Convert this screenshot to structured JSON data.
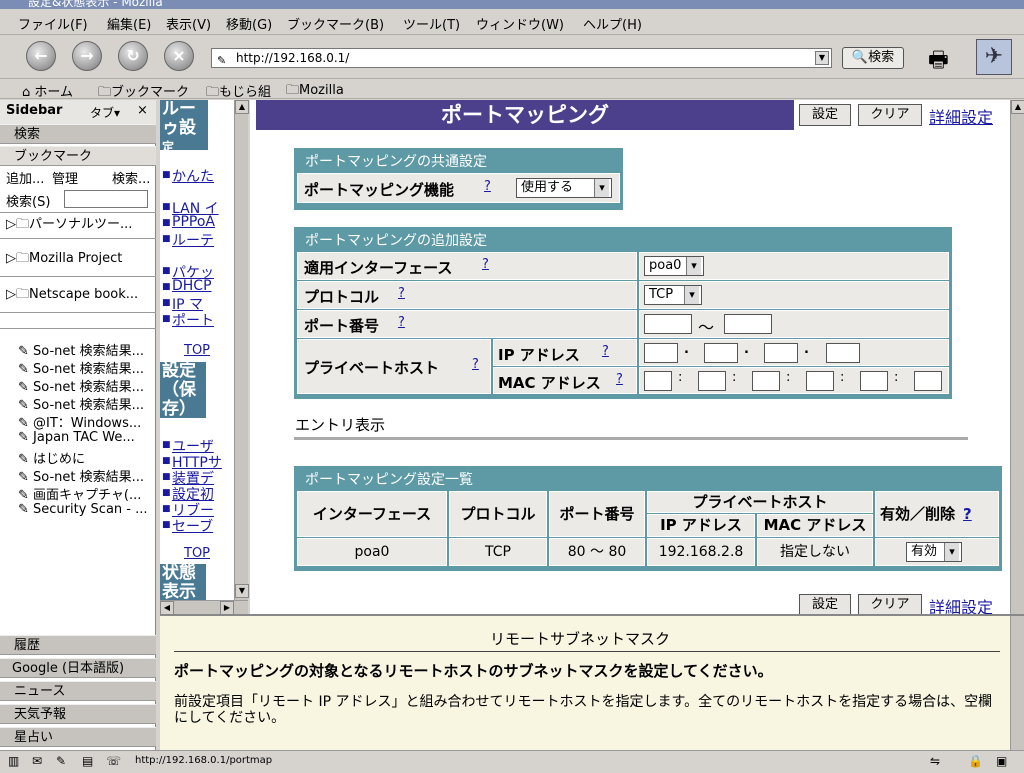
{
  "window": {
    "title": "設定&状態表示 - Mozilla"
  },
  "menu": [
    "ファイル(F)",
    "編集(E)",
    "表示(V)",
    "移動(G)",
    "ブックマーク(B)",
    "ツール(T)",
    "ウィンドウ(W)",
    "ヘルプ(H)"
  ],
  "nav": {
    "url": "http://192.168.0.1/",
    "search_label": "検索"
  },
  "bookmarks_bar": [
    "ホーム",
    "ブックマーク",
    "もじら組",
    "Mozilla"
  ],
  "sidebar": {
    "title": "Sidebar",
    "tabs_label": "タブ",
    "close": "×",
    "tab_search": "検索",
    "tab_bookmarks": "ブックマーク",
    "actions": [
      "追加...",
      "管理",
      "検索..."
    ],
    "search_label": "検索(S)",
    "folders": [
      "パーソナルツー...",
      "Mozilla Project",
      "Netscape book..."
    ],
    "items": [
      "So-net 検索結果...",
      "So-net 検索結果...",
      "So-net 検索結果...",
      "So-net 検索結果...",
      "@IT：Windows...",
      "Japan TAC We...",
      "はじめに",
      "So-net 検索結果...",
      "画面キャプチャ(...",
      "Security Scan - ..."
    ],
    "bottom_tabs": [
      "履歴",
      "Google (日本語版)",
      "ニュース",
      "天気予報",
      "星占い"
    ]
  },
  "navframe": {
    "block1": [
      "ルー",
      "ゥ設",
      "定"
    ],
    "group1": [
      "かんた"
    ],
    "group2": [
      "LAN イ",
      "PPPoA",
      "ルーテ"
    ],
    "group3": [
      "パケッ",
      "DHCP ",
      "IP マ",
      "ポート"
    ],
    "top": "TOP",
    "block2": [
      "設定",
      "（保",
      "存）"
    ],
    "group4": [
      "ユーザ",
      "HTTPサ",
      "装置デ",
      "設定初",
      "リブー",
      "セーブ"
    ],
    "block3": [
      "状態",
      "表示"
    ]
  },
  "page": {
    "title": "ポートマッピング",
    "btn_set": "設定",
    "btn_clear": "クリア",
    "advanced": "詳細設定",
    "help_mark": "?",
    "common": {
      "header": "ポートマッピングの共通設定",
      "label": "ポートマッピング機能",
      "value": "使用する"
    },
    "add": {
      "header": "ポートマッピングの追加設定",
      "iface_label": "適用インターフェース",
      "iface_value": "poa0",
      "proto_label": "プロトコル",
      "proto_value": "TCP",
      "port_label": "ポート番号",
      "tilde": "～",
      "host_label": "プライベートホスト",
      "ip_label": "IP アドレス",
      "mac_label": "MAC アドレス",
      "dot": ".",
      "colon": ":"
    },
    "entry_label": "エントリ表示",
    "list": {
      "header": "ポートマッピング設定一覧",
      "cols": [
        "インターフェース",
        "プロトコル",
        "ポート番号",
        "プライベートホスト",
        "有効／削除"
      ],
      "subcols": [
        "IP アドレス",
        "MAC アドレス"
      ],
      "row": {
        "iface": "poa0",
        "proto": "TCP",
        "port": "80 ～ 80",
        "ip": "192.168.2.8",
        "mac": "指定しない",
        "state": "有効"
      }
    }
  },
  "help": {
    "title": "リモートサブネットマスク",
    "bold": "ポートマッピングの対象となるリモートホストのサブネットマスクを設定してください。",
    "desc": "前設定項目「リモート IP アドレス」と組み合わせてリモートホストを指定します。全てのリモートホストを指定する場合は、空欄にしてください。"
  },
  "status": {
    "url": "http://192.168.0.1/portmap"
  }
}
